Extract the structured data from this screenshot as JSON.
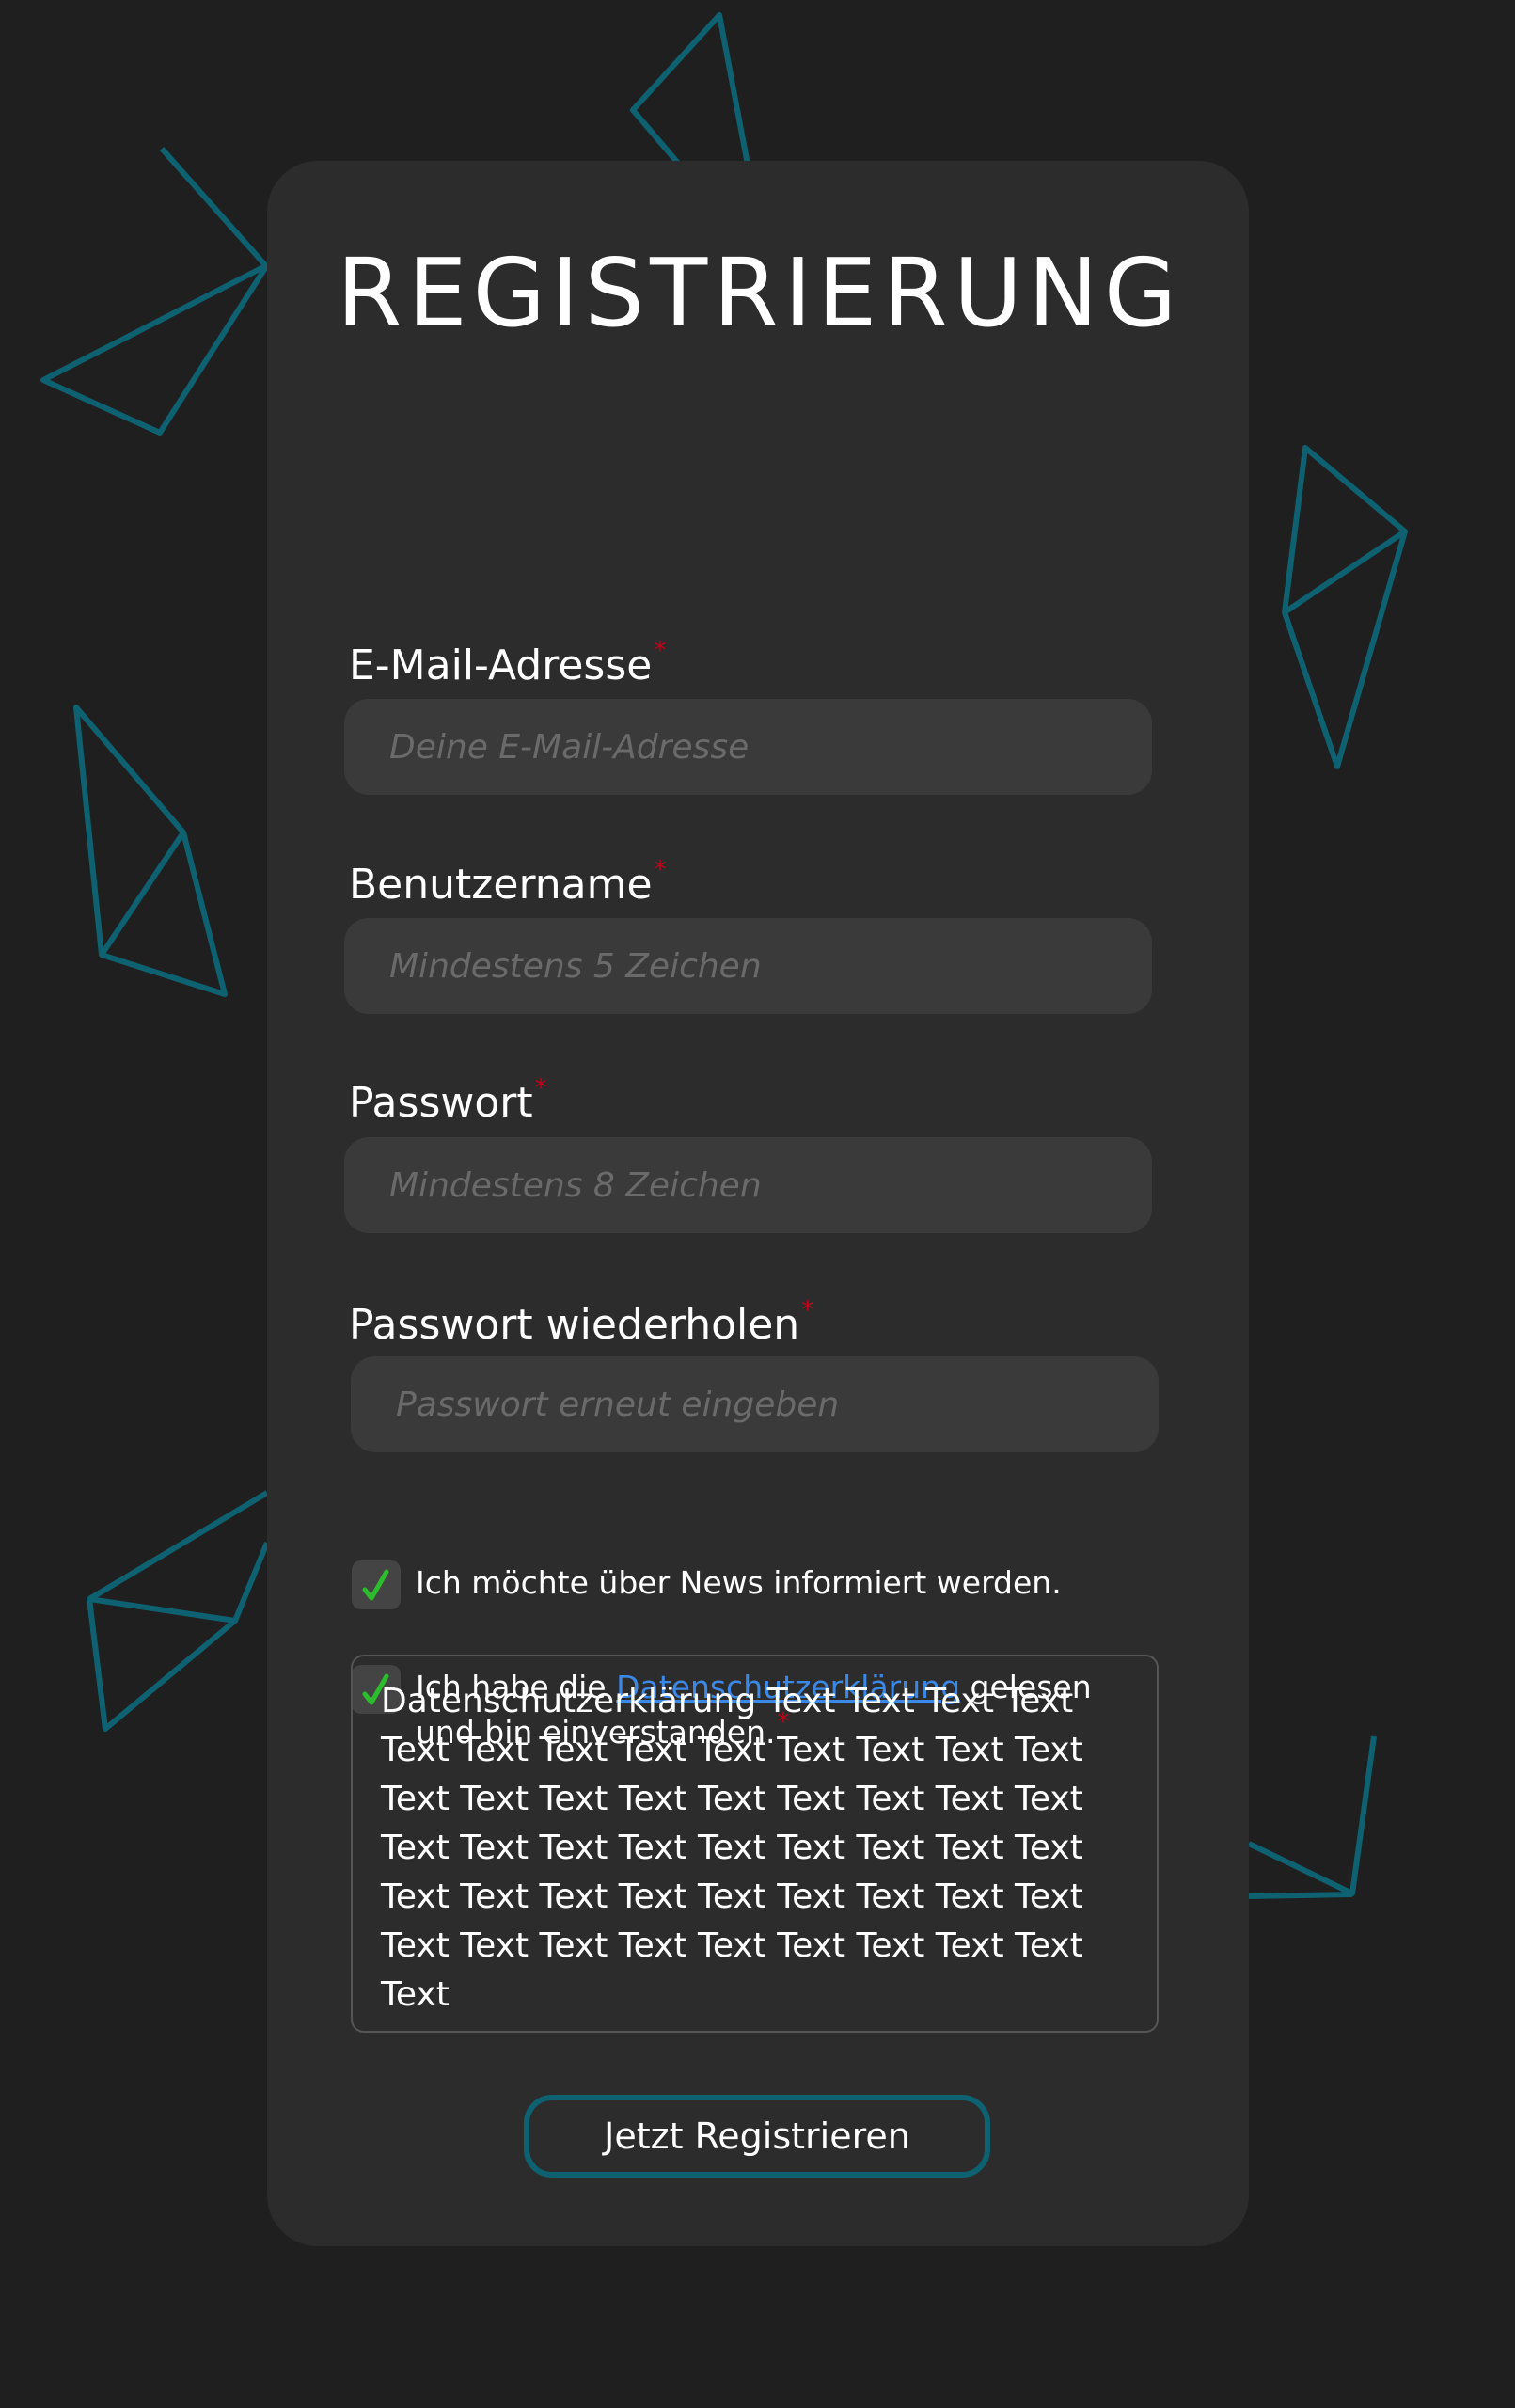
{
  "form": {
    "title": "REGISTRIERUNG",
    "required_marker": "*",
    "fields": [
      {
        "label": "E-Mail-Adresse",
        "placeholder": "Deine E-Mail-Adresse",
        "value": ""
      },
      {
        "label": "Benutzername",
        "placeholder": "Mindestens 5 Zeichen",
        "value": ""
      },
      {
        "label": "Passwort",
        "placeholder": "Mindestens 8 Zeichen",
        "value": ""
      },
      {
        "label": "Passwort wiederholen",
        "placeholder": "Passwort erneut eingeben",
        "value": ""
      }
    ],
    "newsletter": {
      "checked": true,
      "text": "Ich möchte über News informiert werden."
    },
    "privacy_consent": {
      "checked": true,
      "text_before": "Ich habe die ",
      "link_text": "Datenschutzerklärung",
      "text_after": " gelesen",
      "line2": "und bin einverstanden."
    },
    "privacy_text": "Datenschutzerklärung Text Text Text Text Text Text Text Text Text Text Text Text Text Text Text Text Text Text Text Text Text Text Text Text Text Text Text Text Text Text Text Text Text Text Text Text Text Text Text Text Text Text Text Text Text Text Text Text Text Text",
    "submit_label": "Jetzt Registrieren"
  },
  "colors": {
    "background": "#1f1f1f",
    "card": "#2c2c2c",
    "input": "#3a3a3a",
    "accent": "#0d6170",
    "required": "#c4001a",
    "check": "#2bbd2b",
    "link": "#3c88e6"
  },
  "icons": {
    "checkmark": "checkmark-icon",
    "decoration": "triangle-outline"
  }
}
